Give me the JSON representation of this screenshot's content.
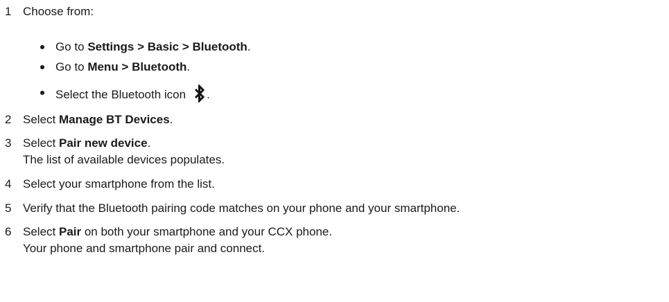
{
  "steps": [
    {
      "number": "1",
      "text": "Choose from:"
    },
    {
      "number": "2",
      "prefix": "Select ",
      "bold": "Manage BT Devices",
      "suffix": "."
    },
    {
      "number": "3",
      "prefix": "Select ",
      "bold": "Pair new device",
      "suffix": ".",
      "result": "The list of available devices populates."
    },
    {
      "number": "4",
      "text": "Select your smartphone from the list."
    },
    {
      "number": "5",
      "text": "Verify that the Bluetooth pairing code matches on your phone and your smartphone."
    },
    {
      "number": "6",
      "prefix": "Select ",
      "bold": "Pair",
      "suffix": " on both your smartphone and your CCX phone.",
      "result": "Your phone and smartphone pair and connect."
    }
  ],
  "choices": [
    {
      "prefix": "Go to ",
      "bold": "Settings > Basic > Bluetooth",
      "suffix": "."
    },
    {
      "prefix": "Go to ",
      "bold": "Menu > Bluetooth",
      "suffix": "."
    },
    {
      "prefix": "Select the Bluetooth icon",
      "suffix": ".",
      "icon": "bluetooth-icon"
    }
  ]
}
